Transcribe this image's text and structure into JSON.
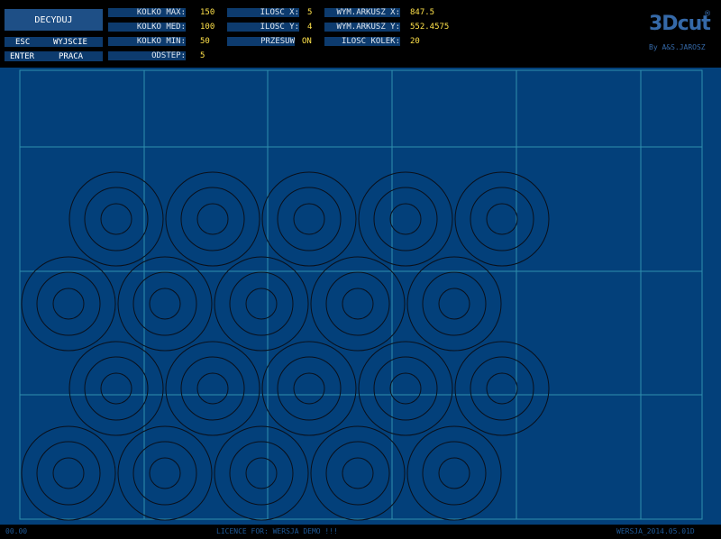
{
  "toolbar": {
    "decide_label": "DECYDUJ",
    "esc_key": "ESC",
    "esc_action": "WYJSCIE",
    "enter_key": "ENTER",
    "enter_action": "PRACA"
  },
  "params": {
    "kolko_max": {
      "label": "KOLKO MAX:",
      "value": "150"
    },
    "kolko_med": {
      "label": "KOLKO MED:",
      "value": "100"
    },
    "kolko_min": {
      "label": "KOLKO MIN:",
      "value": "50"
    },
    "odstep": {
      "label": "ODSTEP:",
      "value": "5"
    },
    "ilosc_x": {
      "label": "ILOSC X:",
      "value": "5"
    },
    "ilosc_y": {
      "label": "ILOSC Y:",
      "value": "4"
    },
    "przesuw": {
      "label": "PRZESUW",
      "value": "ON"
    },
    "wym_x": {
      "label": "WYM.ARKUSZ X:",
      "value": "847.5"
    },
    "wym_y": {
      "label": "WYM.ARKUSZ Y:",
      "value": "552.4575"
    },
    "ilosc_kolek": {
      "label": "ILOSC KOLEK:",
      "value": "20"
    }
  },
  "logo": {
    "name": "3Dcut",
    "mark": "®",
    "byline": "By A&S.JAROSZ"
  },
  "status": {
    "coords": "00.00",
    "licence": "LICENCE FOR: WERSJA DEMO !!!",
    "version": "WERSJA_2014.05.01D"
  },
  "colors": {
    "canvas": "#03407a",
    "grid": "#2f8fae",
    "rings": "#0a0f1a",
    "value_text": "#ffe24a"
  }
}
